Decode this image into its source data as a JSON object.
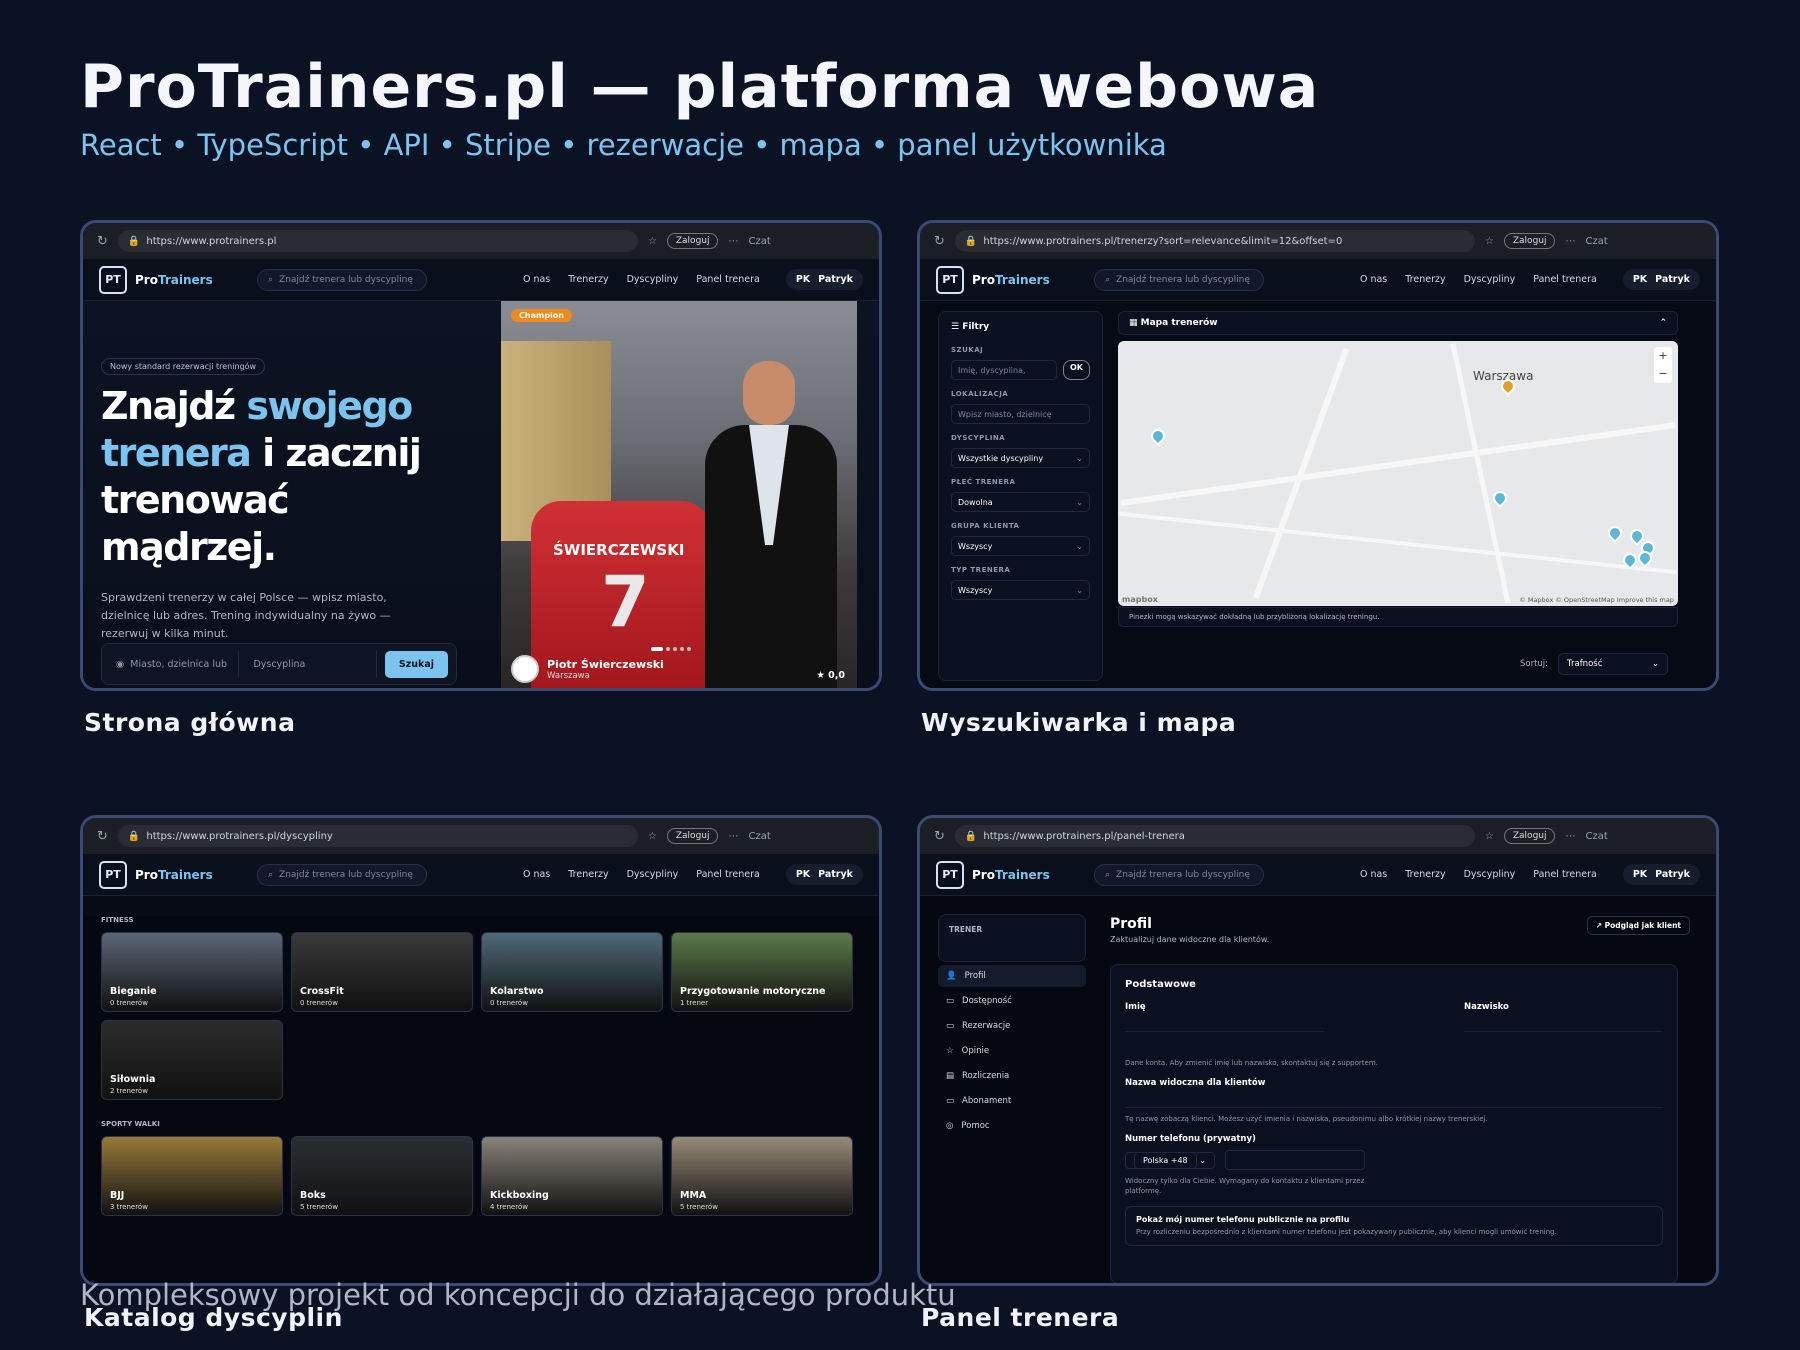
{
  "header": {
    "title": "ProTrainers.pl — platforma webowa",
    "subtitle": "React • TypeScript • API • Stripe • rezerwacje • mapa • panel użytkownika"
  },
  "footer": "Kompleksowy projekt od koncepcji do działającego produktu",
  "captions": [
    "Strona główna",
    "Wyszukiwarka i mapa",
    "Katalog dyscyplin",
    "Panel trenera"
  ],
  "browser": {
    "login": "Zaloguj",
    "chat": "Czat"
  },
  "app": {
    "brand_a": "Pro",
    "brand_b": "Trainers",
    "logo_mark": "PT",
    "search_placeholder": "Znajdź trenera lub dyscyplinę",
    "nav": [
      "O nas",
      "Trenerzy",
      "Dyscypliny",
      "Panel trenera"
    ],
    "user_initials": "PK",
    "user_name": "Patryk"
  },
  "p1": {
    "url": "https://www.protrainers.pl",
    "badge": "Nowy standard rezerwacji treningów",
    "h_a": "Znajdź ",
    "h_b": "swojego trenera",
    "h_c": " i zacznij trenować mądrzej.",
    "desc": "Sprawdzeni trenerzy w całej Polsce — wpisz miasto, dzielnicę lub adres. Trening indywidualny na żywo — rezerwuj w kilka minut.",
    "city_placeholder": "Miasto, dzielnica lub",
    "discipline": "Dyscyplina",
    "search_btn": "Szukaj",
    "champion": "Champion",
    "shirt_name": "ŚWIERCZEWSKI",
    "shirt_number": "7",
    "trainer_name": "Piotr Świerczewski",
    "trainer_city": "Warszawa",
    "rating": "0,0"
  },
  "p2": {
    "url": "https://www.protrainers.pl/trenerzy?sort=relevance&limit=12&offset=0",
    "filters": "Filtry",
    "search_lbl": "SZUKAJ",
    "search_ph": "Imię, dyscyplina,",
    "ok": "OK",
    "loc_lbl": "LOKALIZACJA",
    "loc_ph": "Wpisz miasto, dzielnicę",
    "disc_lbl": "DYSCYPLINA",
    "disc_val": "Wszystkie dyscypliny",
    "sex_lbl": "PŁEĆ TRENERA",
    "sex_val": "Dowolna",
    "group_lbl": "GRUPA KLIENTA",
    "group_val": "Wszyscy",
    "type_lbl": "TYP TRENERA",
    "type_val": "Wszyscy",
    "map_title": "Mapa trenerów",
    "city": "Warszawa",
    "attr": "© Mapbox © OpenStreetMap  Improve this map",
    "mapbox": "mapbox",
    "note": "Pinezki mogą wskazywać dokładną lub przybliżoną lokalizację treningu.",
    "sort_lbl": "Sortuj:",
    "sort_val": "Trafność"
  },
  "p3": {
    "url": "https://www.protrainers.pl/dyscypliny",
    "cat1": "FITNESS",
    "cat2": "SPORTY WALKI",
    "fitness": [
      {
        "name": "Bieganie",
        "count": "0 trenerów",
        "color": "#5c6677"
      },
      {
        "name": "CrossFit",
        "count": "0 trenerów",
        "color": "#3b3a3a"
      },
      {
        "name": "Kolarstwo",
        "count": "0 trenerów",
        "color": "#4e6a78"
      },
      {
        "name": "Przygotowanie motoryczne",
        "count": "1 trener",
        "color": "#5c7a4a"
      },
      {
        "name": "Siłownia",
        "count": "2 trenerów",
        "color": "#2b2b2b"
      }
    ],
    "combat": [
      {
        "name": "BJJ",
        "count": "3 trenerów",
        "color": "#9a7a3a"
      },
      {
        "name": "Boks",
        "count": "5 trenerów",
        "color": "#2a2d33"
      },
      {
        "name": "Kickboxing",
        "count": "4 trenerów",
        "color": "#8a8478"
      },
      {
        "name": "MMA",
        "count": "5 trenerów",
        "color": "#9a8a78"
      }
    ]
  },
  "p4": {
    "url": "https://www.protrainers.pl/panel-trenera",
    "trainer_lbl": "TRENER",
    "menu": [
      "Profil",
      "Dostępność",
      "Rezerwacje",
      "Opinie",
      "Rozliczenia",
      "Abonament",
      "Pomoc"
    ],
    "title": "Profil",
    "sub": "Zaktualizuj dane widoczne dla klientów.",
    "preview": "Podgląd jak klient",
    "section": "Podstawowe",
    "first": "Imię",
    "last": "Nazwisko",
    "note1": "Dane konta. Aby zmienić imię lub nazwisko, skontaktuj się z supportem.",
    "display_lbl": "Nazwa widoczna dla klientów",
    "note2": "Tę nazwę zobaczą klienci. Możesz użyć imienia i nazwiska, pseudonimu albo krótkiej nazwy trenerskiej.",
    "phone_lbl": "Numer telefonu (prywatny)",
    "country": "Polska +48",
    "note3": "Widoczny tylko dla Ciebie. Wymagany do kontaktu z klientami przez platformę.",
    "chk_title": "Pokaż mój numer telefonu publicznie na profilu",
    "chk_desc": "Przy rozliczeniu bezpośrednio z klientami numer telefonu jest pokazywany publicznie, aby klienci mogli umówić trening."
  }
}
